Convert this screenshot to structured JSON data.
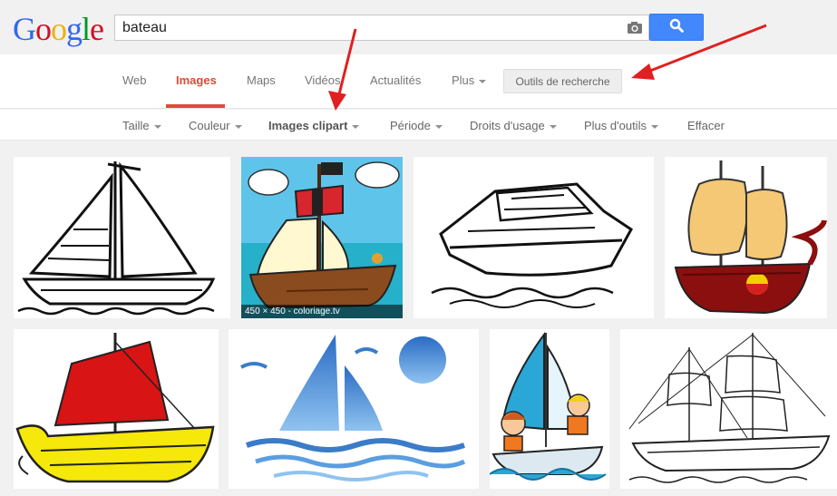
{
  "logo": {
    "letters": [
      "G",
      "o",
      "o",
      "g",
      "l",
      "e"
    ],
    "colors": [
      "#3369e8",
      "#d50f25",
      "#eeb211",
      "#3369e8",
      "#009925",
      "#d50f25"
    ]
  },
  "search": {
    "query": "bateau",
    "camera_icon": "camera-icon",
    "button_icon": "search-icon",
    "button_color": "#4387fd"
  },
  "nav": {
    "items": [
      {
        "label": "Web",
        "active": false
      },
      {
        "label": "Images",
        "active": true
      },
      {
        "label": "Maps",
        "active": false
      },
      {
        "label": "Vidéos",
        "active": false
      },
      {
        "label": "Actualités",
        "active": false
      },
      {
        "label": "Plus",
        "active": false,
        "has_caret": true
      }
    ],
    "tools_label": "Outils de recherche",
    "accent": "#dd4b39"
  },
  "tools": {
    "items": [
      {
        "label": "Taille",
        "has_caret": true
      },
      {
        "label": "Couleur",
        "has_caret": true
      },
      {
        "label": "Images clipart",
        "has_caret": true,
        "selected": true
      },
      {
        "label": "Période",
        "has_caret": true
      },
      {
        "label": "Droits d'usage",
        "has_caret": true
      },
      {
        "label": "Plus d'outils",
        "has_caret": true
      },
      {
        "label": "Effacer",
        "has_caret": false
      }
    ]
  },
  "results": {
    "hovered_caption": "450 × 450 - coloriage.tv",
    "images": [
      "sailboat-outline",
      "pirate-ship-color",
      "motor-yacht-outline",
      "galleon-color",
      "viking-ship-yellow-red",
      "blue-sailboat-logo",
      "kids-sailboat",
      "tall-ship-sketch"
    ]
  },
  "annotation_color": "#e02020"
}
